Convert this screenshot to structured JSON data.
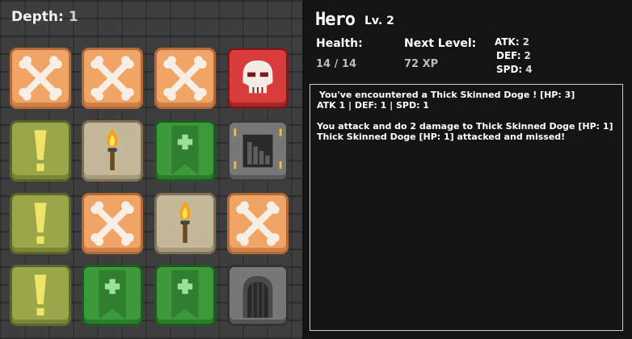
{
  "depth": {
    "label": "Depth:",
    "value": "1"
  },
  "hero": {
    "name": "Hero",
    "level": "Lv. 2",
    "health_label": "Health:",
    "health_value": "14",
    "health_max": "14",
    "next_level_label": "Next Level:",
    "next_level_value": "72 XP",
    "atk_label": "ATK:",
    "atk_value": "2",
    "def_label": "DEF:",
    "def_value": "2",
    "spd_label": "SPD:",
    "spd_value": "4"
  },
  "board": {
    "tiles": [
      [
        "bone",
        "bone",
        "bone",
        "skull"
      ],
      [
        "warning",
        "torch",
        "heal",
        "stairs"
      ],
      [
        "warning",
        "bone",
        "torch",
        "bone"
      ],
      [
        "warning",
        "heal",
        "heal",
        "door"
      ]
    ]
  },
  "log": {
    "lines": [
      "You've encountered a Thick Skinned Doge ! [HP: 3]",
      "ATK 1 | DEF: 1 | SPD: 1",
      "You attack and do 2 damage to Thick Skinned Doge [HP: 1]",
      "Thick Skinned Doge [HP: 1] attacked and missed!"
    ]
  }
}
